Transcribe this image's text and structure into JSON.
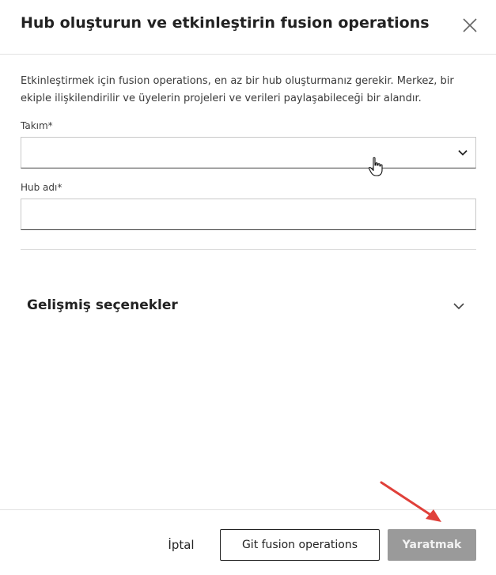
{
  "dialog": {
    "title": "Hub oluşturun ve etkinleştirin fusion operations",
    "description": "Etkinleştirmek için fusion operations, en az bir hub oluşturmanız gerekir. Merkez, bir ekiple ilişkilendirilir ve üyelerin projeleri ve verileri paylaşabileceği bir alandır."
  },
  "form": {
    "team_label": "Takım*",
    "team_value": "",
    "hub_name_label": "Hub adı*",
    "hub_name_value": "",
    "hub_name_placeholder": ""
  },
  "advanced": {
    "label": "Gelişmiş seçenekler",
    "expanded": false
  },
  "footer": {
    "cancel_label": "İptal",
    "secondary_label": "Git fusion operations",
    "primary_label": "Yaratmak",
    "primary_disabled": true
  },
  "colors": {
    "primary_disabled_bg": "#9a9a9a",
    "annotation_arrow": "#e0403a",
    "divider": "#dcdcdc"
  },
  "icons": {
    "close": "close-icon",
    "select_chevron": "chevron-down-icon",
    "advanced_chevron": "chevron-down-icon",
    "cursor": "hand-pointer-icon"
  }
}
